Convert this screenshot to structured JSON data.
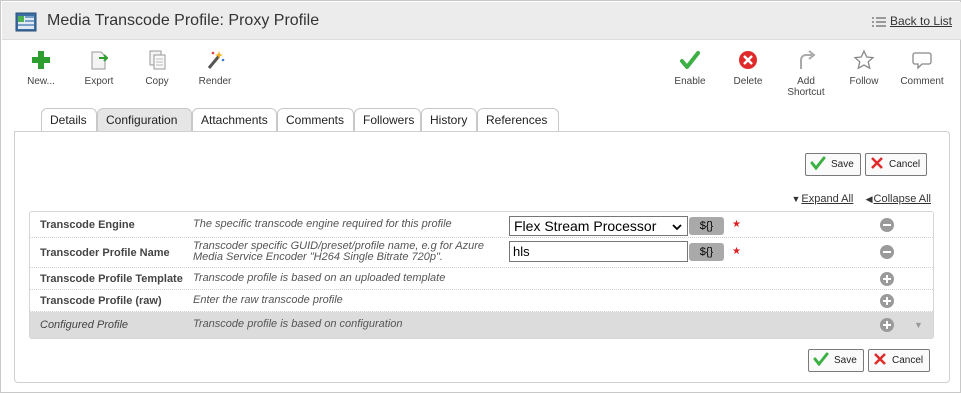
{
  "window": {
    "title": "Media Transcode Profile: Proxy Profile",
    "back_label": "Back to List"
  },
  "toolbar": {
    "new": "New...",
    "export": "Export",
    "copy": "Copy",
    "render": "Render",
    "enable": "Enable",
    "delete": "Delete",
    "add_shortcut_line1": "Add",
    "add_shortcut_line2": "Shortcut",
    "follow": "Follow",
    "comment": "Comment"
  },
  "tabs": [
    "Details",
    "Configuration",
    "Attachments",
    "Comments",
    "Followers",
    "History",
    "References"
  ],
  "active_tab": "Configuration",
  "actions": {
    "save": "Save",
    "cancel": "Cancel",
    "expand_all": "Expand All",
    "collapse_all": "Collapse All"
  },
  "fields": [
    {
      "name": "Transcode Engine",
      "description": "The specific transcode engine required for this profile",
      "control": "select",
      "value": "Flex Stream Processor",
      "var_label": "${}",
      "required_mark": "★"
    },
    {
      "name": "Transcoder Profile Name",
      "description": "Transcoder specific GUID/preset/profile name, e.g for Azure Media Service Encoder \"H264 Single Bitrate 720p\".",
      "control": "text",
      "value": "hls",
      "var_label": "${}",
      "required_mark": "★"
    },
    {
      "name": "Transcode Profile Template",
      "description": "Transcode profile is based on an uploaded template"
    },
    {
      "name": "Transcode Profile (raw)",
      "description": "Enter the raw transcode profile"
    },
    {
      "name": "Configured Profile",
      "description": "Transcode profile is based on configuration"
    }
  ],
  "colors": {
    "enable_green": "#3cb043",
    "delete_red": "#e02b2b",
    "new_green": "#2e9e2e",
    "required_red": "#e02020"
  }
}
